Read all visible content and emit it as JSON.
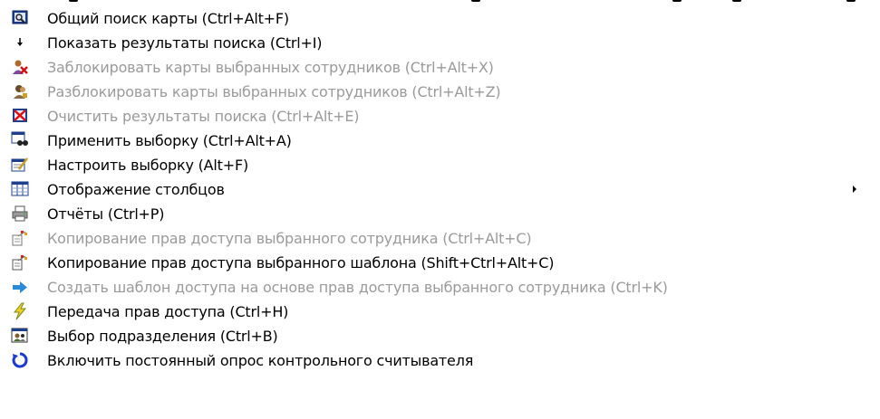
{
  "menu": {
    "items": [
      {
        "label": "Общий поиск карты (Ctrl+Alt+F)",
        "icon": "search-card-icon",
        "enabled": true
      },
      {
        "label": "Показать результаты поиска (Ctrl+I)",
        "icon": "down-arrow-icon",
        "enabled": true
      },
      {
        "label": "Заблокировать  карты выбранных сотрудников (Ctrl+Alt+X)",
        "icon": "block-user-icon",
        "enabled": false
      },
      {
        "label": "Разблокировать карты выбранных сотрудников (Ctrl+Alt+Z)",
        "icon": "unblock-user-icon",
        "enabled": false
      },
      {
        "label": "Очистить результаты поиска (Ctrl+Alt+E)",
        "icon": "clear-results-icon",
        "enabled": false
      },
      {
        "label": "Применить выборку (Ctrl+Alt+A)",
        "icon": "apply-filter-icon",
        "enabled": true
      },
      {
        "label": "Настроить выборку (Alt+F)",
        "icon": "configure-filter-icon",
        "enabled": true
      },
      {
        "label": "Отображение столбцов",
        "icon": "columns-icon",
        "enabled": true,
        "submenu": true
      },
      {
        "label": "Отчёты (Ctrl+P)",
        "icon": "printer-icon",
        "enabled": true
      },
      {
        "label": "Копирование прав доступа выбранного сотрудника (Ctrl+Alt+C)",
        "icon": "copy-rights-icon",
        "enabled": false
      },
      {
        "label": "Копирование прав доступа выбранного шаблона (Shift+Ctrl+Alt+C)",
        "icon": "copy-rights-template-icon",
        "enabled": true
      },
      {
        "label": "Создать шаблон доступа на основе прав доступа выбранного сотрудника (Ctrl+K)",
        "icon": "right-arrow-icon",
        "enabled": false
      },
      {
        "label": "Передача прав доступа (Ctrl+H)",
        "icon": "lightning-icon",
        "enabled": true
      },
      {
        "label": "Выбор подразделения (Ctrl+B)",
        "icon": "department-icon",
        "enabled": true
      },
      {
        "label": "Включить постоянный опрос контрольного считывателя",
        "icon": "refresh-icon",
        "enabled": true
      }
    ]
  },
  "colors": {
    "enabled_text": "#000000",
    "disabled_text": "#9a9a9a",
    "background": "#ffffff"
  }
}
